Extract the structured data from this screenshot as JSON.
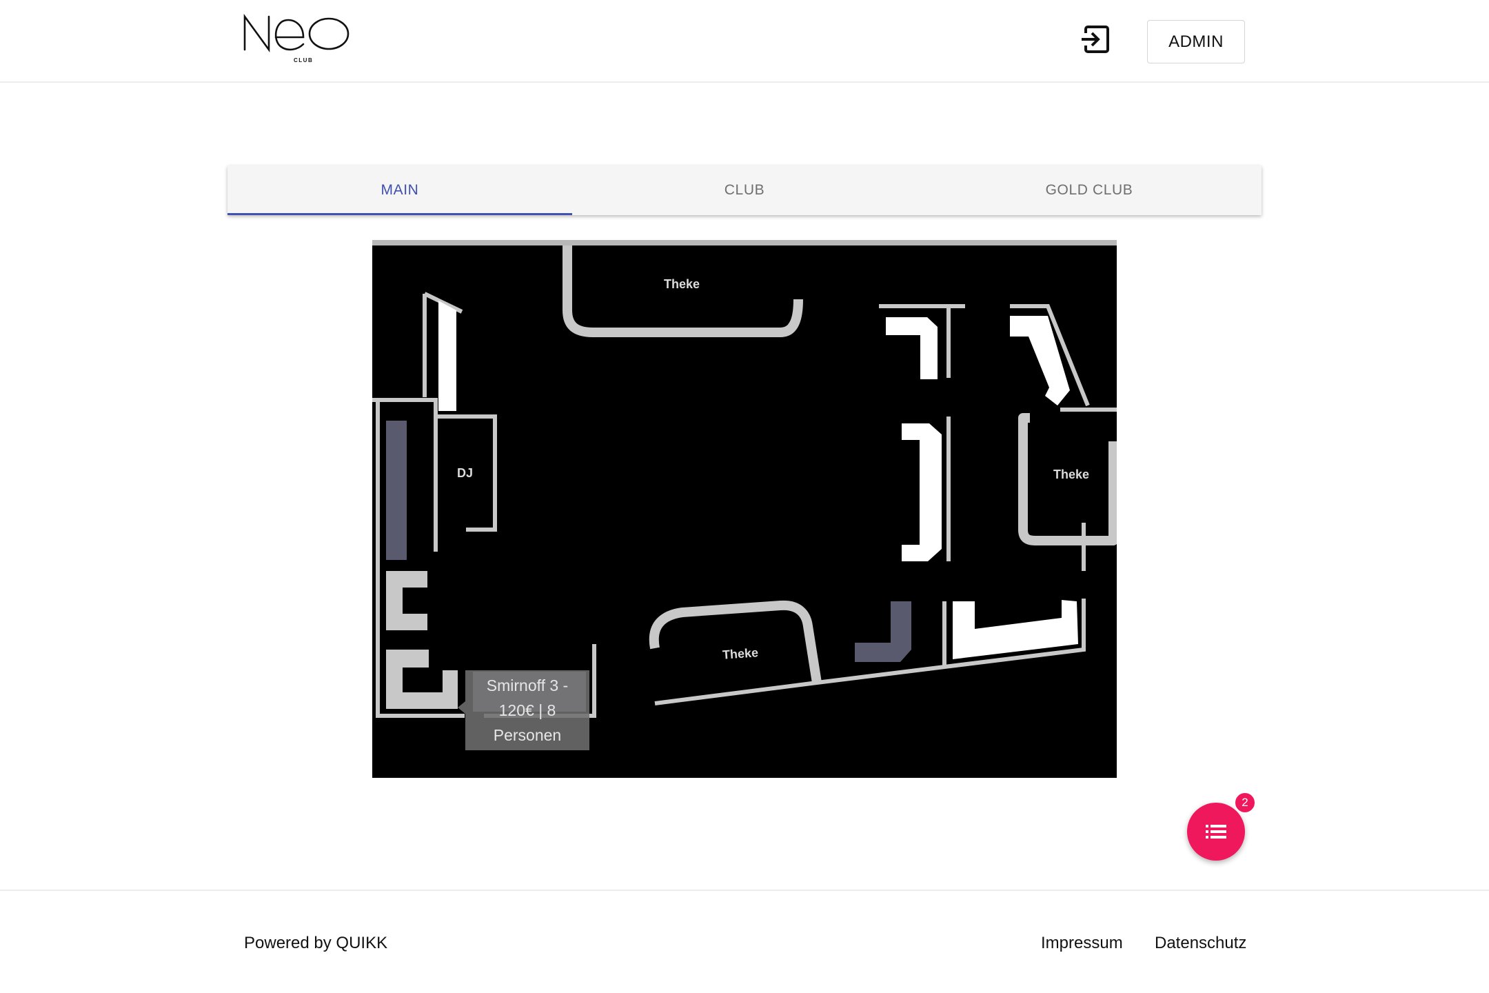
{
  "header": {
    "logo_text": "neo",
    "logo_subtext": "CLUB",
    "login_icon": "login-icon",
    "admin_label": "ADMIN"
  },
  "tabs": [
    {
      "label": "MAIN",
      "active": true
    },
    {
      "label": "CLUB",
      "active": false
    },
    {
      "label": "GOLD CLUB",
      "active": false
    }
  ],
  "floorplan": {
    "labels": {
      "bar_top": "Theke",
      "dj": "DJ",
      "bar_right": "Theke",
      "bar_bottom": "Theke"
    },
    "tooltip": "Smirnoff 3 - 120€ | 8 Personen"
  },
  "fab": {
    "icon": "list-icon",
    "badge": "2",
    "color": "#f0185d"
  },
  "footer": {
    "powered": "Powered by QUIKK",
    "impressum": "Impressum",
    "datenschutz": "Datenschutz"
  },
  "colors": {
    "accent": "#3f51b5",
    "plan_background": "#000000",
    "wall": "#c8c8c8",
    "table_available": "#ffffff",
    "table_reserved": "#5a5a6e"
  }
}
